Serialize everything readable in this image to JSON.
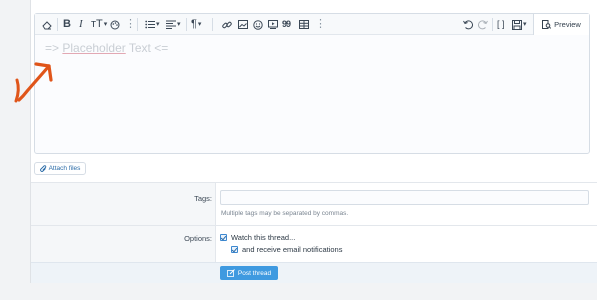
{
  "editor": {
    "placeholder_prefix": "=> ",
    "placeholder_word": "Placeholder",
    "placeholder_suffix": " Text <=",
    "preview_label": "Preview",
    "toolbar_icons": [
      "eraser-icon",
      "bold-icon",
      "italic-icon",
      "text-size-icon",
      "palette-icon",
      "more-icon",
      "list-icon",
      "align-icon",
      "paragraph-icon",
      "link-icon",
      "image-icon",
      "smiley-icon",
      "media-icon",
      "quote-icon",
      "table-icon",
      "undo-icon",
      "redo-icon",
      "bbcode-icon",
      "drafts-icon",
      "preview-icon"
    ],
    "bold_glyph": "B",
    "italic_glyph": "I",
    "textsize_glyph": "тT",
    "paragraph_glyph": "¶",
    "quote_glyph": "99",
    "more_glyph": "⋮",
    "bbcode_glyph": "[ ]"
  },
  "attach": {
    "label": "Attach files"
  },
  "form": {
    "tags_label": "Tags:",
    "tags_hint": "Multiple tags may be separated by commas.",
    "options_label": "Options:",
    "watch_label": "Watch this thread...",
    "email_label": "and receive email notifications"
  },
  "submit": {
    "label": "Post thread"
  },
  "colors": {
    "accent": "#3f9ae0",
    "annotation": "#e0551a",
    "placeholder": "#c9ced4"
  }
}
